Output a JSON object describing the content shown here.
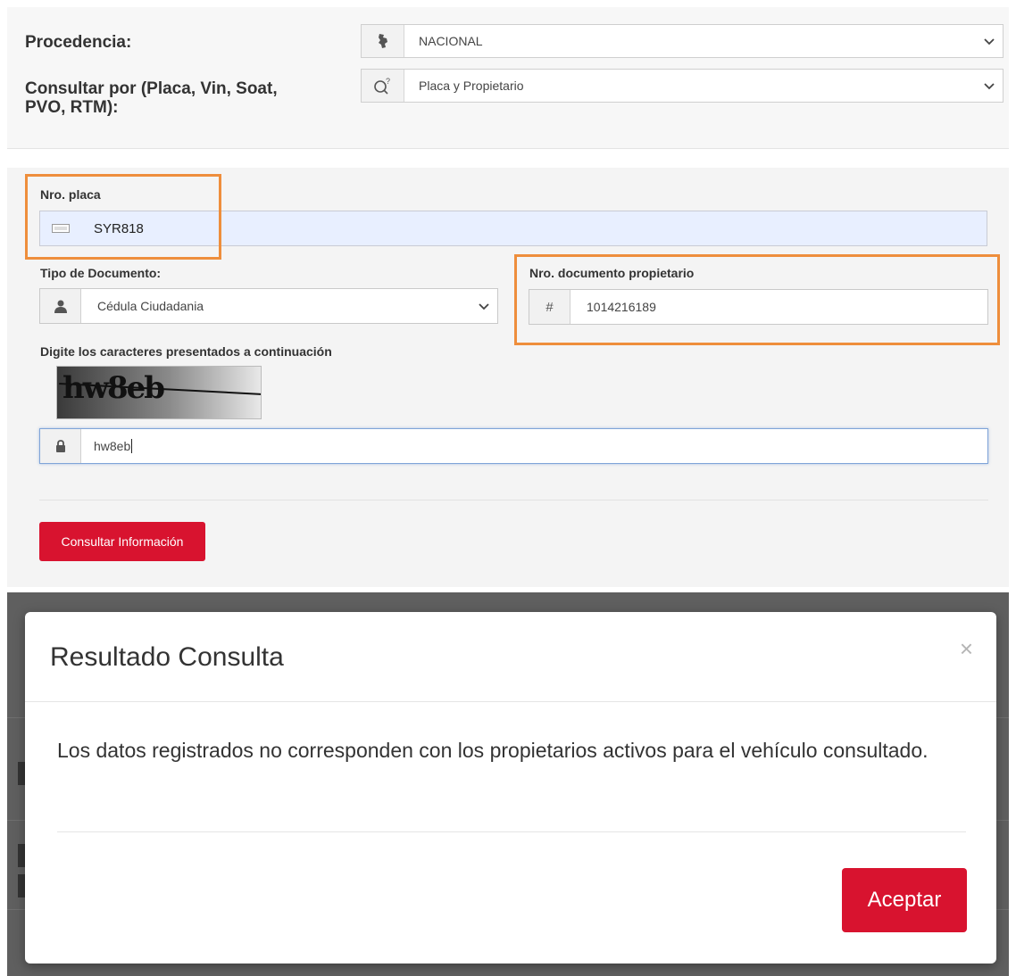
{
  "top": {
    "procedencia_label": "Procedencia:",
    "procedencia_value": "NACIONAL",
    "consultar_label": "Consultar por (Placa, Vin, Soat, PVO, RTM):",
    "consultar_value": "Placa y Propietario"
  },
  "form": {
    "placa_label": "Nro. placa",
    "placa_value": "SYR818",
    "tipo_doc_label": "Tipo de Documento:",
    "tipo_doc_value": "Cédula Ciudadania",
    "nro_doc_label": "Nro. documento propietario",
    "nro_doc_value": "1014216189",
    "captcha_label": "Digite los caracteres presentados a continuación",
    "captcha_image_text": "hw8eb",
    "captcha_value": "hw8eb",
    "submit_label": "Consultar Información"
  },
  "modal": {
    "title": "Resultado Consulta",
    "close_symbol": "×",
    "message": "Los datos registrados no corresponden con los propietarios activos para el vehículo consultado.",
    "accept_label": "Aceptar"
  },
  "colors": {
    "accent_red": "#d8132f",
    "highlight_orange": "#ee8e3c"
  }
}
